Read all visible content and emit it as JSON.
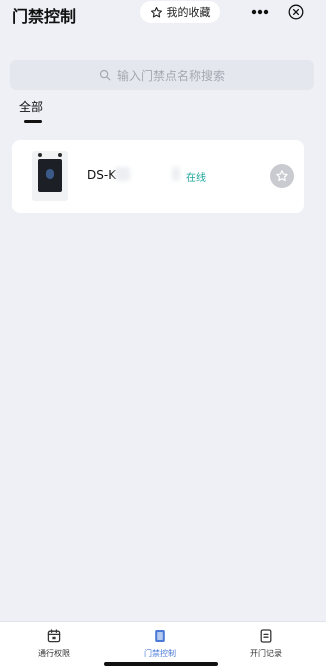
{
  "header": {
    "title": "门禁控制",
    "favorites_label": "我的收藏"
  },
  "search": {
    "placeholder": "输入门禁点名称搜索"
  },
  "tabs": [
    {
      "label": "全部",
      "active": true
    }
  ],
  "devices": [
    {
      "name": "DS-K",
      "status": "在线",
      "status_color": "#19a59a"
    }
  ],
  "tabbar": {
    "items": [
      {
        "label": "通行权限",
        "icon": "calendar-icon",
        "active": false
      },
      {
        "label": "门禁控制",
        "icon": "door-icon",
        "active": true
      },
      {
        "label": "开门记录",
        "icon": "record-icon",
        "active": false
      }
    ],
    "active_color": "#4a79d8"
  }
}
